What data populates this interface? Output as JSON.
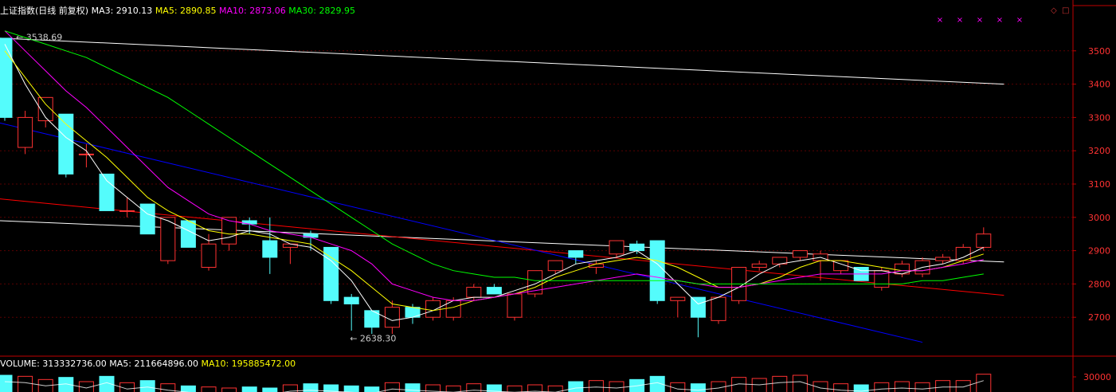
{
  "header": {
    "title": "上证指数(日线 前复权)",
    "ma3": "MA3: 2910.13",
    "ma5": "MA5: 2890.85",
    "ma10": "MA10: 2873.06",
    "ma30": "MA30: 2829.95"
  },
  "volume_header": {
    "volume": "VOLUME: 313332736.00",
    "ma5": "MA5: 211664896.00",
    "ma10": "MA10: 195885472.00"
  },
  "controls": {
    "diamond_icon": "diamond-icon",
    "square_icon": "square-icon"
  },
  "colors": {
    "background": "#000000",
    "up": "#ff3232",
    "down": "#54fcfc",
    "ma3": "#ffffff",
    "ma5": "#ffff00",
    "ma10": "#ff00ff",
    "ma30": "#00ff00",
    "axis": "#c00000",
    "axis_text": "#ff3232"
  },
  "chart_data": [
    {
      "type": "candlestick",
      "ylim": [
        2600,
        3600
      ],
      "y_ticks": [
        2700,
        2800,
        2900,
        3000,
        3100,
        3200,
        3300,
        3400,
        3500
      ],
      "grid": true,
      "annotations": {
        "high": "3538.69",
        "low": "2638.30"
      },
      "candles": [
        [
          3538,
          3538,
          3290,
          3300
        ],
        [
          3210,
          3320,
          3190,
          3300
        ],
        [
          3290,
          3320,
          3270,
          3360
        ],
        [
          3310,
          3310,
          3120,
          3130
        ],
        [
          3190,
          3220,
          3150,
          3190
        ],
        [
          3130,
          3130,
          3050,
          3020
        ],
        [
          3020,
          3060,
          3000,
          3020
        ],
        [
          3040,
          3040,
          2950,
          2950
        ],
        [
          2870,
          2920,
          2860,
          3000
        ],
        [
          2990,
          2990,
          2920,
          2910
        ],
        [
          2850,
          2950,
          2840,
          2920
        ],
        [
          2920,
          3000,
          2900,
          3000
        ],
        [
          2990,
          3000,
          2950,
          2980
        ],
        [
          2930,
          3000,
          2830,
          2880
        ],
        [
          2910,
          2920,
          2860,
          2920
        ],
        [
          2950,
          2960,
          2900,
          2940
        ],
        [
          2910,
          2910,
          2740,
          2750
        ],
        [
          2760,
          2770,
          2660,
          2740
        ],
        [
          2720,
          2720,
          2650,
          2670
        ],
        [
          2670,
          2750,
          2650,
          2730
        ],
        [
          2730,
          2740,
          2680,
          2700
        ],
        [
          2700,
          2760,
          2690,
          2750
        ],
        [
          2700,
          2760,
          2690,
          2750
        ],
        [
          2760,
          2800,
          2750,
          2790
        ],
        [
          2790,
          2800,
          2780,
          2770
        ],
        [
          2700,
          2770,
          2690,
          2770
        ],
        [
          2770,
          2840,
          2760,
          2840
        ],
        [
          2840,
          2870,
          2830,
          2870
        ],
        [
          2900,
          2900,
          2860,
          2880
        ],
        [
          2850,
          2870,
          2830,
          2860
        ],
        [
          2890,
          2930,
          2880,
          2930
        ],
        [
          2920,
          2930,
          2890,
          2900
        ],
        [
          2930,
          2930,
          2740,
          2750
        ],
        [
          2750,
          2760,
          2700,
          2760
        ],
        [
          2760,
          2760,
          2640,
          2700
        ],
        [
          2690,
          2760,
          2680,
          2760
        ],
        [
          2750,
          2850,
          2740,
          2850
        ],
        [
          2850,
          2870,
          2840,
          2860
        ],
        [
          2860,
          2880,
          2850,
          2880
        ],
        [
          2880,
          2900,
          2870,
          2900
        ],
        [
          2870,
          2900,
          2810,
          2890
        ],
        [
          2840,
          2870,
          2830,
          2870
        ],
        [
          2850,
          2850,
          2810,
          2810
        ],
        [
          2790,
          2850,
          2780,
          2840
        ],
        [
          2830,
          2870,
          2820,
          2860
        ],
        [
          2830,
          2880,
          2820,
          2870
        ],
        [
          2870,
          2890,
          2860,
          2880
        ],
        [
          2870,
          2920,
          2860,
          2910
        ],
        [
          2910,
          2970,
          2900,
          2950
        ]
      ],
      "ma_series": [
        {
          "name": "MA3",
          "values": [
            3520,
            3400,
            3300,
            3240,
            3200,
            3110,
            3060,
            3010,
            2990,
            2960,
            2930,
            2940,
            2960,
            2950,
            2920,
            2910,
            2870,
            2810,
            2720,
            2690,
            2700,
            2720,
            2750,
            2760,
            2760,
            2780,
            2800,
            2830,
            2860,
            2870,
            2880,
            2900,
            2860,
            2800,
            2740,
            2760,
            2790,
            2830,
            2860,
            2870,
            2880,
            2860,
            2840,
            2840,
            2830,
            2850,
            2860,
            2880,
            2910
          ]
        },
        {
          "name": "MA5",
          "values": [
            3500,
            3420,
            3340,
            3280,
            3230,
            3180,
            3120,
            3060,
            3020,
            2990,
            2960,
            2950,
            2950,
            2940,
            2930,
            2920,
            2880,
            2840,
            2790,
            2740,
            2730,
            2720,
            2730,
            2750,
            2760,
            2770,
            2790,
            2820,
            2840,
            2860,
            2870,
            2880,
            2870,
            2850,
            2820,
            2790,
            2790,
            2800,
            2820,
            2850,
            2870,
            2870,
            2860,
            2850,
            2840,
            2840,
            2850,
            2870,
            2890
          ]
        },
        {
          "name": "MA10",
          "values": [
            3560,
            3500,
            3440,
            3380,
            3330,
            3270,
            3210,
            3150,
            3090,
            3050,
            3010,
            2990,
            2980,
            2960,
            2950,
            2940,
            2920,
            2900,
            2860,
            2800,
            2780,
            2760,
            2750,
            2750,
            2760,
            2770,
            2780,
            2790,
            2800,
            2810,
            2820,
            2830,
            2820,
            2810,
            2800,
            2790,
            2790,
            2800,
            2810,
            2820,
            2830,
            2830,
            2830,
            2830,
            2840,
            2840,
            2850,
            2860,
            2873
          ]
        },
        {
          "name": "MA30",
          "values": [
            3560,
            3540,
            3520,
            3500,
            3480,
            3450,
            3420,
            3390,
            3360,
            3320,
            3280,
            3240,
            3200,
            3160,
            3120,
            3080,
            3040,
            3000,
            2960,
            2920,
            2890,
            2860,
            2840,
            2830,
            2820,
            2820,
            2810,
            2810,
            2810,
            2810,
            2810,
            2810,
            2810,
            2810,
            2800,
            2800,
            2800,
            2800,
            2800,
            2800,
            2800,
            2800,
            2800,
            2800,
            2800,
            2810,
            2810,
            2820,
            2830
          ]
        }
      ],
      "trend_lines": [
        {
          "color": "#ffffff",
          "from": [
            -24,
            3050
          ],
          "to": [
            49,
            2866
          ]
        },
        {
          "color": "#ff0000",
          "from": [
            -24,
            3195
          ],
          "to": [
            49,
            2766
          ]
        },
        {
          "color": "#ff0000",
          "from": [
            -24,
            2770
          ],
          "to": [
            -1,
            2640
          ]
        },
        {
          "color": "#0000ff",
          "from": [
            -24,
            2950
          ],
          "to": [
            -1,
            2645
          ]
        },
        {
          "color": "#0000ff",
          "from": [
            -22,
            3600
          ],
          "to": [
            45,
            2625
          ]
        },
        {
          "color": "#ffffff",
          "from": [
            -8,
            3560
          ],
          "to": [
            49,
            3400
          ]
        },
        {
          "color": "#ffffff",
          "from": [
            -24,
            2640
          ],
          "to": [
            -22,
            2630
          ]
        }
      ],
      "markers": [
        "×",
        "×",
        "×",
        "×",
        "×"
      ]
    },
    {
      "type": "bar",
      "series_name": "VOLUME",
      "y_ticks": [
        30000
      ],
      "values": [
        32000,
        31000,
        28000,
        30000,
        26000,
        31000,
        25000,
        27000,
        24000,
        22000,
        21000,
        20000,
        21000,
        20000,
        23000,
        24000,
        23000,
        22000,
        21000,
        25000,
        24000,
        23000,
        22000,
        24000,
        23000,
        22000,
        23000,
        22000,
        26000,
        27000,
        26000,
        28000,
        31000,
        25000,
        24000,
        26000,
        30000,
        29000,
        31000,
        32000,
        26000,
        24000,
        23000,
        25000,
        26000,
        25000,
        27000,
        27000,
        33000
      ]
    }
  ]
}
